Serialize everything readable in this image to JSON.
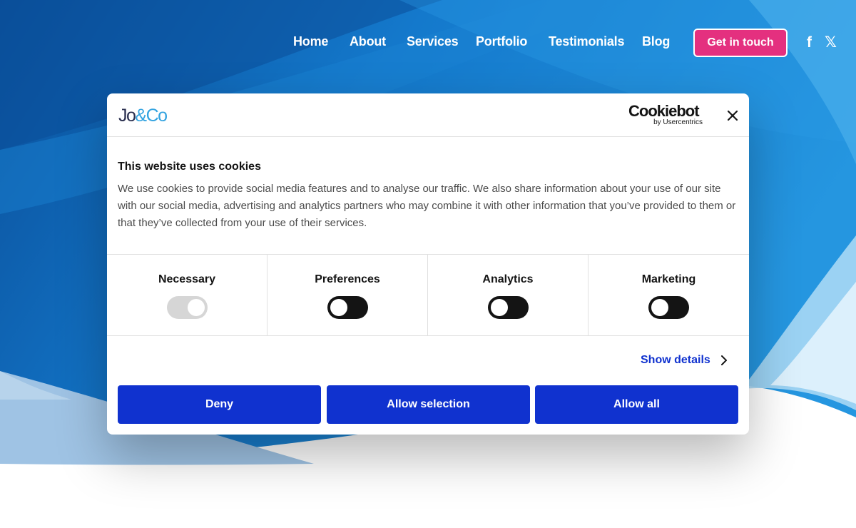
{
  "nav": {
    "links": [
      {
        "label": "Home"
      },
      {
        "label": "About"
      },
      {
        "label": "Services"
      },
      {
        "label": "Portfolio"
      },
      {
        "label": "Testimonials"
      },
      {
        "label": "Blog"
      }
    ],
    "cta_label": "Get in touch",
    "social": [
      {
        "icon": "facebook-icon",
        "glyph": "f"
      },
      {
        "icon": "x-twitter-icon",
        "glyph": "𝕏"
      }
    ]
  },
  "dialog": {
    "brand_logo": {
      "part1": "Jo",
      "part2": "&Co"
    },
    "provider_logo": {
      "name": "Cookiebot",
      "sub": "by Usercentrics"
    },
    "title": "This website uses cookies",
    "body": "We use cookies to provide social media features and to analyse our traffic. We also share information about your use of our site with our social media, advertising and analytics partners who may combine it with other information that you’ve provided to them or that they’ve collected from your use of their services.",
    "categories": [
      {
        "label": "Necessary",
        "enabled": true,
        "locked": true
      },
      {
        "label": "Preferences",
        "enabled": false,
        "locked": false
      },
      {
        "label": "Analytics",
        "enabled": false,
        "locked": false
      },
      {
        "label": "Marketing",
        "enabled": false,
        "locked": false
      }
    ],
    "show_details_label": "Show details",
    "buttons": {
      "deny": "Deny",
      "allow_selection": "Allow selection",
      "allow_all": "Allow all"
    }
  },
  "colors": {
    "primary_button": "#1032cf",
    "cta": "#e4307f",
    "toggle_off": "#141414",
    "toggle_disabled": "#d6d6d6",
    "hero_blue": "#1a7fd0"
  }
}
